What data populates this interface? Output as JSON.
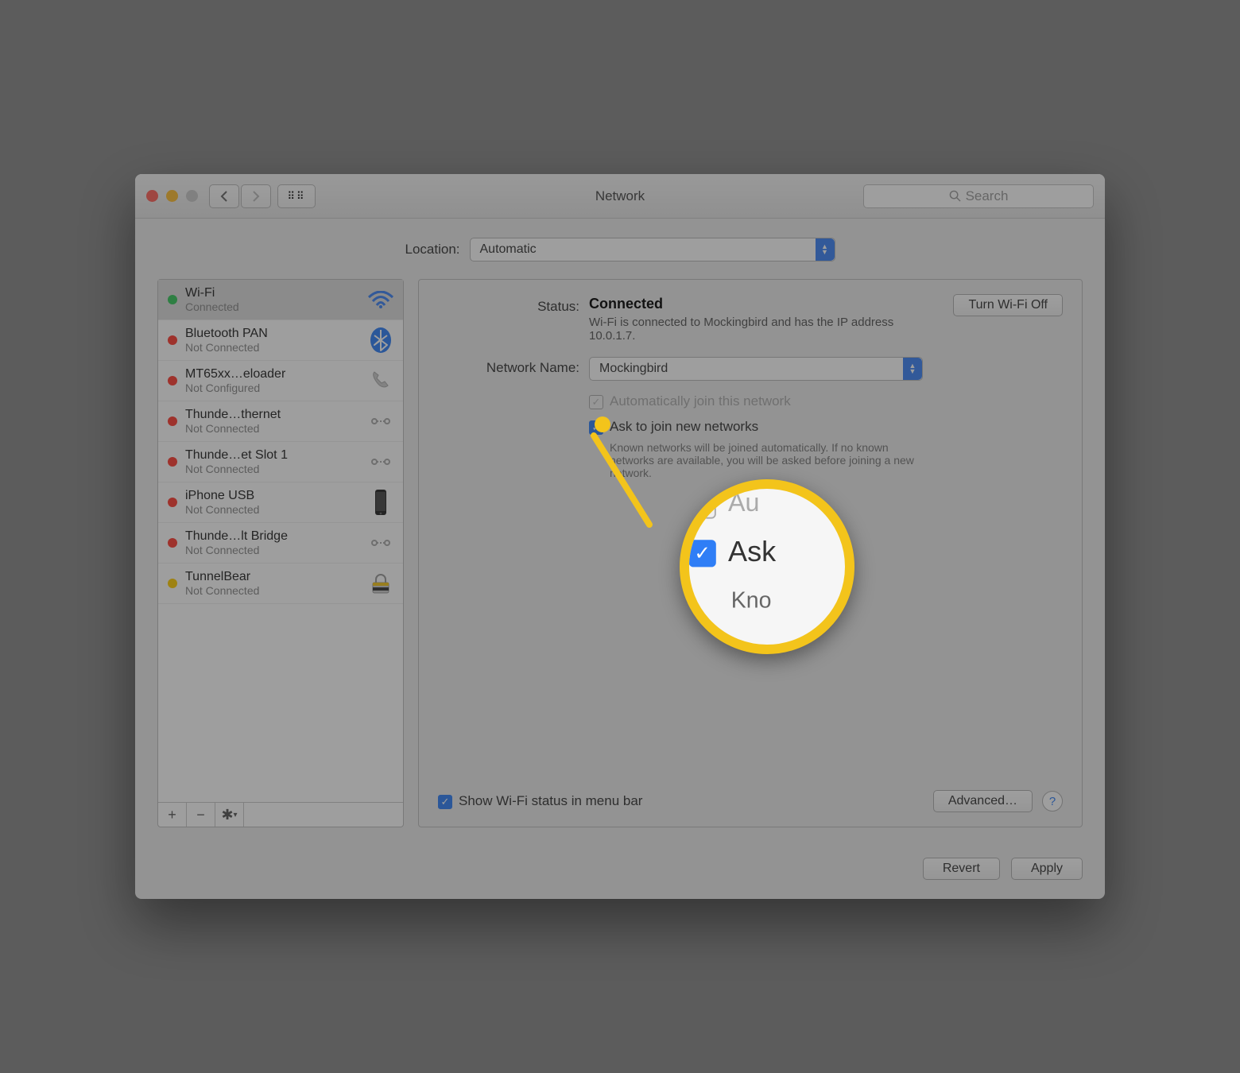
{
  "window": {
    "title": "Network",
    "search_placeholder": "Search"
  },
  "location": {
    "label": "Location:",
    "value": "Automatic"
  },
  "sidebar": {
    "items": [
      {
        "name": "Wi-Fi",
        "status": "Connected",
        "dot": "green",
        "icon": "wifi"
      },
      {
        "name": "Bluetooth PAN",
        "status": "Not Connected",
        "dot": "red",
        "icon": "bluetooth"
      },
      {
        "name": "MT65xx…eloader",
        "status": "Not Configured",
        "dot": "red",
        "icon": "phone"
      },
      {
        "name": "Thunde…thernet",
        "status": "Not Connected",
        "dot": "red",
        "icon": "thunderbolt"
      },
      {
        "name": "Thunde…et Slot 1",
        "status": "Not Connected",
        "dot": "red",
        "icon": "thunderbolt"
      },
      {
        "name": "iPhone USB",
        "status": "Not Connected",
        "dot": "red",
        "icon": "iphone"
      },
      {
        "name": "Thunde…lt Bridge",
        "status": "Not Connected",
        "dot": "red",
        "icon": "thunderbolt"
      },
      {
        "name": "TunnelBear",
        "status": "Not Connected",
        "dot": "yellow",
        "icon": "lock"
      }
    ],
    "add": "+",
    "remove": "−",
    "gear": "✳"
  },
  "detail": {
    "status_label": "Status:",
    "status_value": "Connected",
    "status_desc": "Wi-Fi is connected to Mockingbird and has the IP address 10.0.1.7.",
    "turnoff": "Turn Wi-Fi Off",
    "netname_label": "Network Name:",
    "netname_value": "Mockingbird",
    "auto_join_label": "Automatically join this network",
    "ask_join_label": "Ask to join new networks",
    "ask_join_help": "Known networks will be joined automatically. If no known networks are available, you will be asked before joining a new network.",
    "show_status_label": "Show Wi-Fi status in menu bar",
    "advanced": "Advanced…",
    "help": "?"
  },
  "footer": {
    "revert": "Revert",
    "apply": "Apply"
  },
  "magnifier": {
    "line1_cb_label": "Au",
    "line2_cb_label": "Ask",
    "line3": "Kno"
  }
}
